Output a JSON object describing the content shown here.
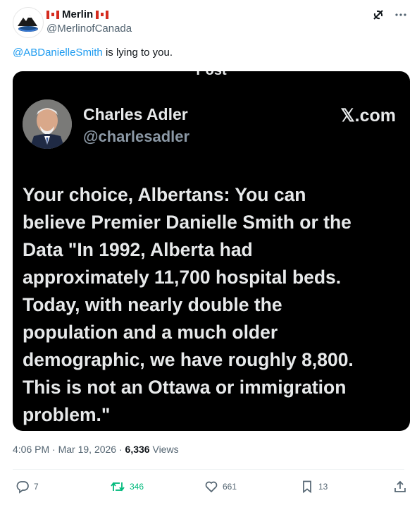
{
  "author": {
    "name": "Merlin",
    "handle": "@MerlinofCanada"
  },
  "tweet": {
    "mention": "@ABDanielleSmith",
    "text": " is lying to you."
  },
  "embedded": {
    "top_cut_label": "Post",
    "name": "Charles Adler",
    "handle": "@charlesadler",
    "source": "𝕏.com",
    "body": "Your choice, Albertans: You can\nbelieve Premier Danielle Smith or the\nData \"In 1992, Alberta had\napproximately 11,700 hospital beds.\nToday, with nearly double the\npopulation and a much older\ndemographic, we have roughly 8,800.\nThis is not an Ottawa or immigration\nproblem.\""
  },
  "meta": {
    "time": "4:06 PM",
    "separator": " · ",
    "date": "Mar 19, 2026",
    "separator2": " · ",
    "views_count": "6,336",
    "views_label": " Views"
  },
  "actions": {
    "replies": "7",
    "reposts": "346",
    "likes": "661",
    "bookmarks": "13"
  },
  "colors": {
    "accent": "#1d9bf0",
    "repost_active": "#00ba7c",
    "muted": "#536471"
  },
  "icons": [
    "grok-icon",
    "more-icon",
    "reply-icon",
    "repost-icon",
    "like-icon",
    "bookmark-icon",
    "share-icon"
  ]
}
